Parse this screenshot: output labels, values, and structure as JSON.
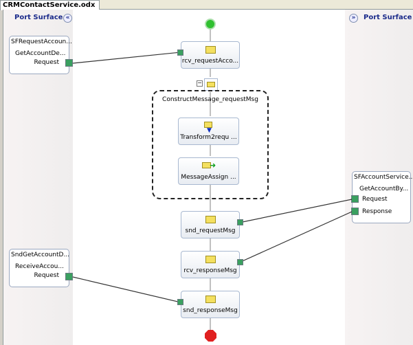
{
  "tab": {
    "title": "CRMContactService.odx"
  },
  "left_port_surface": {
    "title": "Port Surface",
    "collapse_icon": "chevron-double-left-icon",
    "ports": [
      {
        "name": "SFRequestAccoun...",
        "operation": "GetAccountDe...",
        "message": "Request"
      },
      {
        "name": "SndGetAccountD...",
        "operation": "ReceiveAccou...",
        "message": "Request"
      }
    ]
  },
  "right_port_surface": {
    "title": "Port Surface",
    "collapse_icon": "chevron-double-right-icon",
    "ports": [
      {
        "name": "SFAccountService...",
        "operation": "GetAccountBy...",
        "request": "Request",
        "response": "Response"
      }
    ]
  },
  "orchestration": {
    "shapes": [
      {
        "label": "rcv_requestAcco...",
        "type": "receive"
      },
      {
        "label": "Transform2requ ...",
        "type": "transform"
      },
      {
        "label": "MessageAssign ...",
        "type": "message-assignment"
      },
      {
        "label": "snd_requestMsg",
        "type": "send"
      },
      {
        "label": "rcv_responseMsg",
        "type": "receive"
      },
      {
        "label": "snd_responseMsg",
        "type": "send"
      }
    ],
    "construct_scope": {
      "label": "ConstructMessage_requestMsg",
      "collapse": "−"
    }
  },
  "colors": {
    "start": "#30c030",
    "end": "#e02020",
    "port": "#3aa060",
    "title": "#1a2a8a"
  }
}
